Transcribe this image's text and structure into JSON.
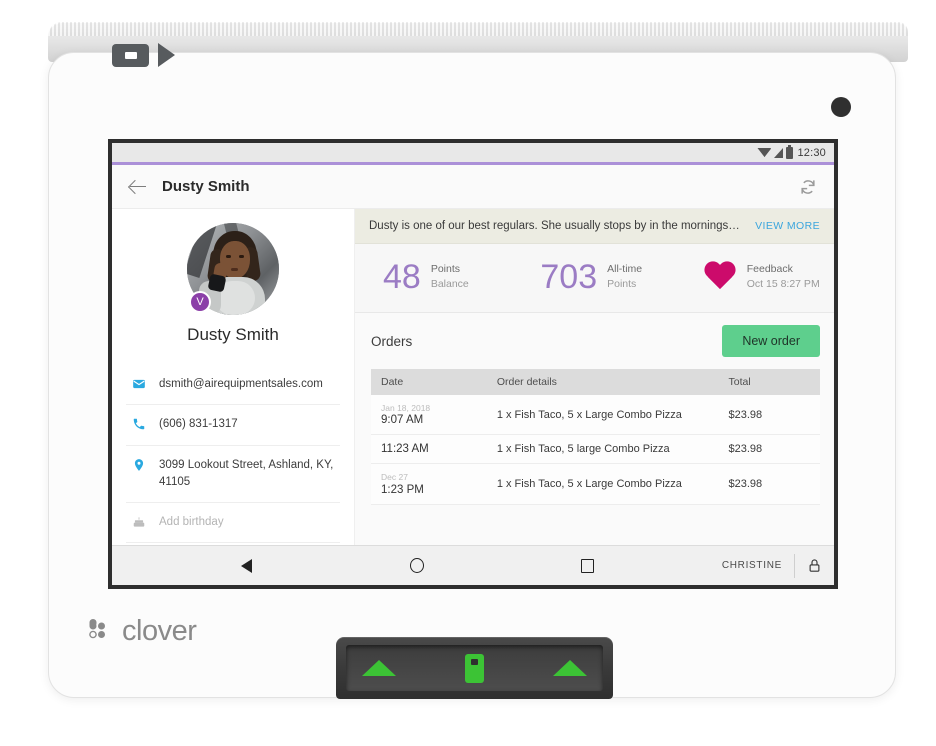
{
  "device": {
    "brand": "clover",
    "printer_icons": [
      "card-slot-icon",
      "play-triangle-icon"
    ],
    "reader_icons": [
      "arrow-up-left-icon",
      "card-insert-icon",
      "arrow-up-right-icon"
    ]
  },
  "status_bar": {
    "time": "12:30",
    "icons": [
      "wifi-icon",
      "signal-icon",
      "battery-icon"
    ]
  },
  "appbar": {
    "title": "Dusty Smith",
    "back_icon": "back-arrow-icon",
    "refresh_icon": "refresh-icon"
  },
  "customer": {
    "name": "Dusty Smith",
    "badge": "V",
    "badge_color": "#8b3fa8",
    "contacts": [
      {
        "icon": "email-icon",
        "value": "dsmith@airequipmentsales.com",
        "muted": false
      },
      {
        "icon": "phone-icon",
        "value": "(606) 831-1317",
        "muted": false
      },
      {
        "icon": "location-icon",
        "value": "3099 Lookout Street, Ashland, KY, 41105",
        "muted": false
      },
      {
        "icon": "cake-icon",
        "value": "Add birthday",
        "muted": true
      }
    ]
  },
  "note": {
    "text": "Dusty is one of our best regulars. She usually stops by in the mornings…",
    "view_more_label": "VIEW MORE",
    "link_color": "#3aa5dd",
    "background": "#ecece2"
  },
  "stats": [
    {
      "value": "48",
      "label": "Points",
      "sublabel": "Balance",
      "color": "#9b7cc4",
      "icon": null
    },
    {
      "value": "703",
      "label": "All-time",
      "sublabel": "Points",
      "color": "#9b7cc4",
      "icon": null
    },
    {
      "value": null,
      "label": "Feedback",
      "sublabel": "Oct 15 8:27 PM",
      "color": "#cc0b6b",
      "icon": "heart-icon"
    }
  ],
  "orders": {
    "title": "Orders",
    "new_order_label": "New order",
    "new_order_color": "#5ecf8d",
    "columns": [
      "Date",
      "Order details",
      "Total"
    ],
    "rows": [
      {
        "date_group": "Jan 18, 2018",
        "time": "9:07 AM",
        "details": "1 x Fish Taco, 5 x Large Combo Pizza",
        "total": "$23.98"
      },
      {
        "date_group": "",
        "time": "11:23 AM",
        "details": "1 x Fish Taco, 5 large Combo Pizza",
        "total": "$23.98"
      },
      {
        "date_group": "Dec 27",
        "time": "1:23 PM",
        "details": "1 x Fish Taco, 5 x Large Combo Pizza",
        "total": "$23.98"
      }
    ]
  },
  "nav": {
    "back_icon": "nav-back-icon",
    "home_icon": "nav-home-icon",
    "recents_icon": "nav-recents-icon",
    "user": "CHRISTINE",
    "lock_icon": "lock-icon"
  }
}
